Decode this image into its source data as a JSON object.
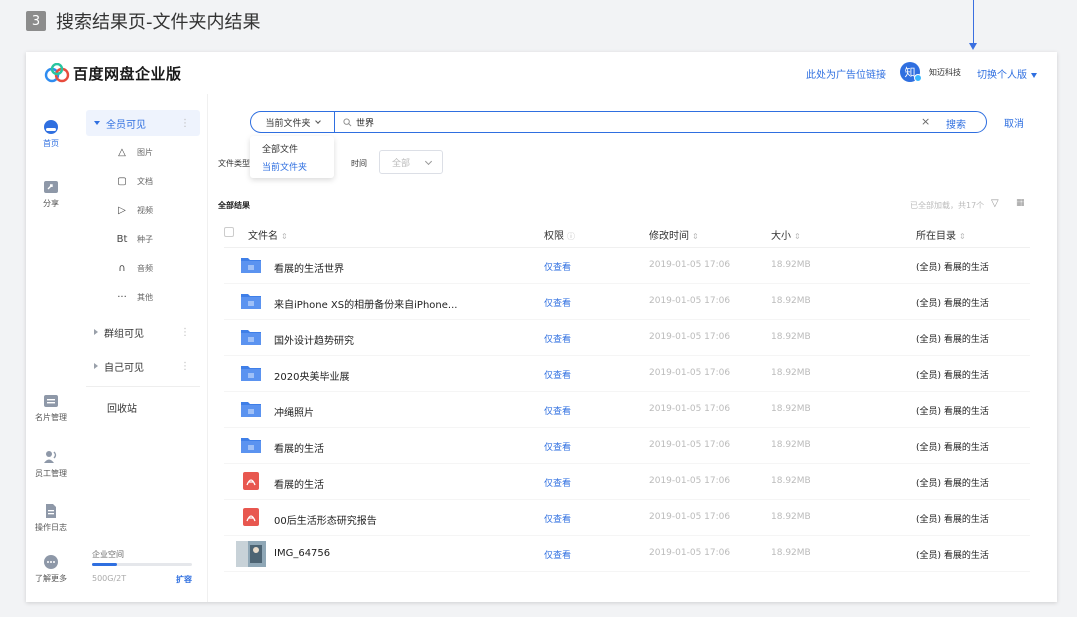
{
  "annotation": {
    "number": "3",
    "title": "搜索结果页-文件夹内结果"
  },
  "header": {
    "brand": "百度网盘企业版",
    "ad_link": "此处为广告位链接",
    "avatar_char": "知",
    "company": "知迈科技",
    "switch_label": "切换个人版"
  },
  "rail": [
    {
      "label": "首页",
      "icon": "cloud-icon"
    },
    {
      "label": "分享",
      "icon": "share-icon"
    },
    {
      "label": "名片管理",
      "icon": "card-icon"
    },
    {
      "label": "员工管理",
      "icon": "staff-icon"
    },
    {
      "label": "操作日志",
      "icon": "log-icon"
    },
    {
      "label": "了解更多",
      "icon": "more-icon"
    }
  ],
  "nav": {
    "public": "全员可见",
    "sub": [
      {
        "label": "图片",
        "icon": "△"
      },
      {
        "label": "文档",
        "icon": "▢"
      },
      {
        "label": "视频",
        "icon": "▷"
      },
      {
        "label": "种子",
        "icon": "Bt"
      },
      {
        "label": "音频",
        "icon": "∩"
      },
      {
        "label": "其他",
        "icon": "···"
      }
    ],
    "group": "群组可见",
    "self": "自己可见",
    "recycle": "回收站",
    "storage_label": "企业空间",
    "storage_text": "500G/2T",
    "storage_used": 0.25,
    "expand": "扩容"
  },
  "search": {
    "scope": "当前文件夹",
    "query": "世界",
    "button": "搜索",
    "cancel": "取消",
    "clear": "×",
    "options": [
      "全部文件",
      "当前文件夹"
    ]
  },
  "filters": {
    "type_label": "文件类型",
    "time_label": "时间",
    "time_value": "全部"
  },
  "results": {
    "title": "全部结果",
    "loaded": "已全部加载，共17个",
    "columns": [
      "文件名",
      "权限",
      "修改时间",
      "大小",
      "所在目录"
    ],
    "rows": [
      {
        "icon": "folder",
        "name": "看展的生活世界",
        "perm": "仅查看",
        "time": "2019-01-05 17:06",
        "size": "18.92MB",
        "dir": "(全员) 看展的生活"
      },
      {
        "icon": "folder",
        "name": "来自iPhone XS的相册备份来自iPhone...",
        "perm": "仅查看",
        "time": "2019-01-05 17:06",
        "size": "18.92MB",
        "dir": "(全员) 看展的生活"
      },
      {
        "icon": "folder",
        "name": "国外设计趋势研究",
        "perm": "仅查看",
        "time": "2019-01-05 17:06",
        "size": "18.92MB",
        "dir": "(全员) 看展的生活"
      },
      {
        "icon": "folder",
        "name": "2020央美毕业展",
        "perm": "仅查看",
        "time": "2019-01-05 17:06",
        "size": "18.92MB",
        "dir": "(全员) 看展的生活"
      },
      {
        "icon": "folder",
        "name": "冲绳照片",
        "perm": "仅查看",
        "time": "2019-01-05 17:06",
        "size": "18.92MB",
        "dir": "(全员) 看展的生活"
      },
      {
        "icon": "folder",
        "name": "看展的生活",
        "perm": "仅查看",
        "time": "2019-01-05 17:06",
        "size": "18.92MB",
        "dir": "(全员) 看展的生活"
      },
      {
        "icon": "pdf",
        "name": "看展的生活",
        "perm": "仅查看",
        "time": "2019-01-05 17:06",
        "size": "18.92MB",
        "dir": "(全员) 看展的生活"
      },
      {
        "icon": "pdf",
        "name": "00后生活形态研究报告",
        "perm": "仅查看",
        "time": "2019-01-05 17:06",
        "size": "18.92MB",
        "dir": "(全员) 看展的生活"
      },
      {
        "icon": "image",
        "name": "IMG_64756",
        "perm": "仅查看",
        "time": "2019-01-05 17:06",
        "size": "18.92MB",
        "dir": "(全员) 看展的生活"
      }
    ]
  },
  "colors": {
    "accent": "#2f6fe0",
    "folder": "#3f7fe8",
    "pdf": "#e8574f"
  }
}
